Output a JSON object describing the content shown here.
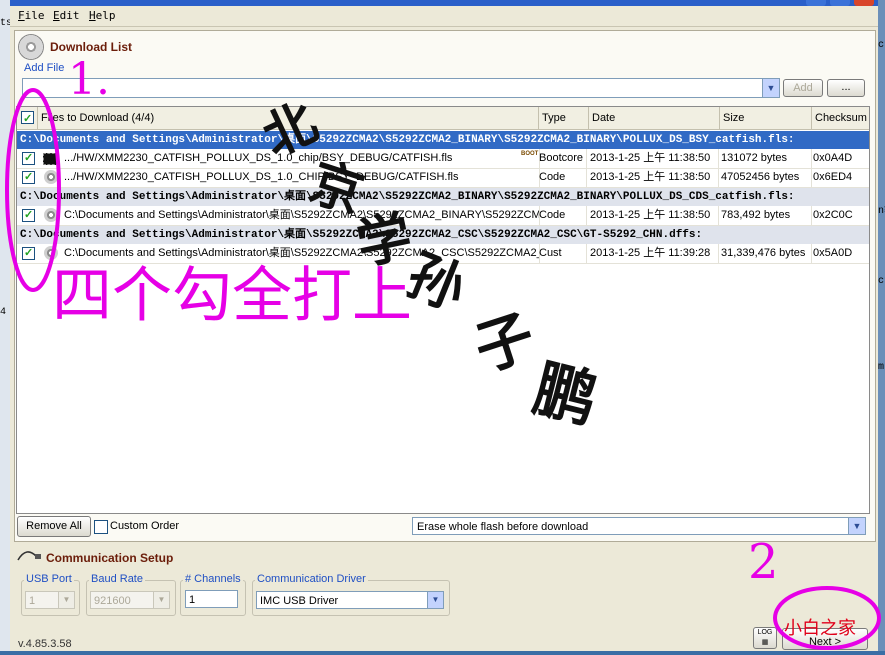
{
  "stray_left": [
    "ts",
    "4"
  ],
  "stray_right": [
    "ct",
    "n¥",
    "ct",
    "m"
  ],
  "menu": [
    {
      "label": "File",
      "accel": "F",
      "rest": "ile"
    },
    {
      "label": "Edit",
      "accel": "E",
      "rest": "dit"
    },
    {
      "label": "Help",
      "accel": "H",
      "rest": "elp"
    }
  ],
  "download": {
    "title": "Download List",
    "add_file_link": "Add File",
    "add_button": "Add",
    "browse_button": "...",
    "columns": {
      "files": "Files to Download (4/4)",
      "type": "Type",
      "date": "Date",
      "size": "Size",
      "checksum": "Checksum"
    },
    "groups": [
      {
        "path": "C:\\Documents and Settings\\Administrator\\桌面\\S5292ZCMA2\\S5292ZCMA2_BINARY\\S5292ZCMA2_BINARY\\POLLUX_DS_BSY_catfish.fls:"
      },
      {
        "path": "C:\\Documents and Settings\\Administrator\\桌面\\S5292ZCMA2\\S5292ZCMA2_BINARY\\S5292ZCMA2_BINARY\\POLLUX_DS_CDS_catfish.fls:"
      },
      {
        "path": "C:\\Documents and Settings\\Administrator\\桌面\\S5292ZCMA2\\S5292ZCMA2_CSC\\S5292ZCMA2_CSC\\GT-S5292_CHN.dffs:"
      }
    ],
    "rows": [
      {
        "file": ".../HW/XMM2230_CATFISH_POLLUX_DS_1.0_chip/BSY_DEBUG/CATFISH.fls",
        "type": "Bootcore",
        "date": "2013-1-25 上午 11:38:50",
        "size": "131072 bytes",
        "checksum": "0x0A4D",
        "icon": "chip-icon"
      },
      {
        "file": ".../HW/XMM2230_CATFISH_POLLUX_DS_1.0_CHIP/BSY_DEBUG/CATFISH.fls",
        "type": "Code",
        "date": "2013-1-25 上午 11:38:50",
        "size": "47052456 bytes",
        "checksum": "0x6ED4",
        "icon": "disc-icon"
      },
      {
        "file": "C:\\Documents and Settings\\Administrator\\桌面\\S5292ZCMA2\\S5292ZCMA2_BINARY\\S5292ZCMA2",
        "type": "Code",
        "date": "2013-1-25 上午 11:38:50",
        "size": "783,492 bytes",
        "checksum": "0x2C0C",
        "icon": "disc-icon"
      },
      {
        "file": "C:\\Documents and Settings\\Administrator\\桌面\\S5292ZCMA2\\S5292ZCMA2_CSC\\S5292ZCMA2_CSC",
        "type": "Cust",
        "date": "2013-1-25 上午 11:39:28",
        "size": "31,339,476 bytes",
        "checksum": "0x5A0D",
        "icon": "disc-icon"
      }
    ],
    "boot_tag": "BOOT",
    "remove_all": "Remove All",
    "custom_order": "Custom Order",
    "erase_option": "Erase whole flash before download"
  },
  "comm": {
    "title": "Communication Setup",
    "usb_port_label": "USB Port",
    "usb_port_value": "1",
    "baud_rate_label": "Baud Rate",
    "baud_rate_value": "921600",
    "channels_label": "# Channels",
    "channels_value": "1",
    "driver_label": "Communication Driver",
    "driver_value": "IMC USB Driver"
  },
  "footer": {
    "version": "v.4.85.3.58",
    "log_label": "LOG",
    "next_button": "Next >"
  },
  "annotations": {
    "step1": "1.",
    "step2": "2",
    "note_cn": "四个勾全打上",
    "site_cn": "小白之家",
    "calligraphy": [
      "北",
      "京",
      "学",
      "孙",
      "子",
      "鹏"
    ]
  },
  "colors": {
    "annotation": "#e600e6",
    "selected_group": "#316ac5",
    "check": "#21a121"
  }
}
